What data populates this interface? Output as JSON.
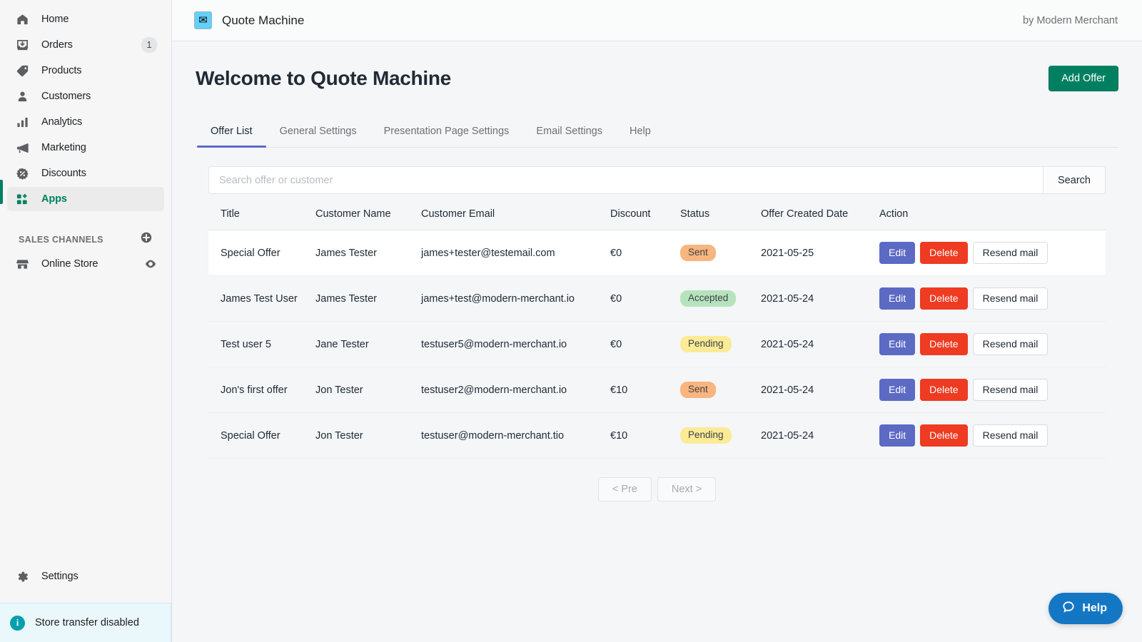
{
  "sidebar": {
    "items": [
      {
        "label": "Home",
        "icon": "home-icon",
        "badge": ""
      },
      {
        "label": "Orders",
        "icon": "orders-icon",
        "badge": "1"
      },
      {
        "label": "Products",
        "icon": "tag-icon",
        "badge": ""
      },
      {
        "label": "Customers",
        "icon": "person-icon",
        "badge": ""
      },
      {
        "label": "Analytics",
        "icon": "bar-chart-icon",
        "badge": ""
      },
      {
        "label": "Marketing",
        "icon": "megaphone-icon",
        "badge": ""
      },
      {
        "label": "Discounts",
        "icon": "discount-icon",
        "badge": ""
      },
      {
        "label": "Apps",
        "icon": "apps-icon",
        "badge": ""
      }
    ],
    "section_title": "SALES CHANNELS",
    "add_channel_icon": "plus-circle-icon",
    "channels": [
      {
        "label": "Online Store",
        "icon": "store-icon",
        "action_icon": "eye-icon"
      }
    ],
    "settings_label": "Settings",
    "settings_icon": "gear-icon",
    "banner": {
      "text": "Store transfer disabled",
      "icon": "info-icon"
    },
    "active_item": "Apps",
    "accent_color": "#008060"
  },
  "topbar": {
    "app_icon": "envelope-icon",
    "app_name": "Quote Machine",
    "author": "by Modern Merchant"
  },
  "page": {
    "title": "Welcome to Quote Machine",
    "add_offer_label": "Add Offer"
  },
  "tabs": [
    {
      "label": "Offer List",
      "active": true
    },
    {
      "label": "General Settings",
      "active": false
    },
    {
      "label": "Presentation Page Settings",
      "active": false
    },
    {
      "label": "Email Settings",
      "active": false
    },
    {
      "label": "Help",
      "active": false
    }
  ],
  "search": {
    "placeholder": "Search offer or customer",
    "value": "",
    "button_label": "Search"
  },
  "table": {
    "headers": [
      "Title",
      "Customer Name",
      "Customer Email",
      "Discount",
      "Status",
      "Offer Created Date",
      "Action"
    ],
    "action_labels": {
      "edit": "Edit",
      "delete": "Delete",
      "resend": "Resend mail"
    },
    "rows": [
      {
        "title": "Special Offer",
        "customer_name": "James Tester",
        "customer_email": "james+tester@testemail.com",
        "discount": "€0",
        "status": "Sent",
        "status_kind": "sent",
        "created": "2021-05-25",
        "highlight": true
      },
      {
        "title": "James Test User",
        "customer_name": "James Tester",
        "customer_email": "james+test@modern-merchant.io",
        "discount": "€0",
        "status": "Accepted",
        "status_kind": "accepted",
        "created": "2021-05-24",
        "highlight": false
      },
      {
        "title": "Test user 5",
        "customer_name": "Jane Tester",
        "customer_email": "testuser5@modern-merchant.io",
        "discount": "€0",
        "status": "Pending",
        "status_kind": "pending",
        "created": "2021-05-24",
        "highlight": false
      },
      {
        "title": "Jon's first offer",
        "customer_name": "Jon Tester",
        "customer_email": "testuser2@modern-merchant.io",
        "discount": "€10",
        "status": "Sent",
        "status_kind": "sent",
        "created": "2021-05-24",
        "highlight": false
      },
      {
        "title": "Special Offer",
        "customer_name": "Jon Tester",
        "customer_email": "testuser@modern-merchant.tio",
        "discount": "€10",
        "status": "Pending",
        "status_kind": "pending",
        "created": "2021-05-24",
        "highlight": false
      }
    ]
  },
  "pagination": {
    "prev_label": "< Pre",
    "next_label": "Next >"
  },
  "help_fab": {
    "label": "Help",
    "icon": "chat-bubble-icon",
    "color": "#1477c4"
  },
  "colors": {
    "accent_green": "#008060",
    "tab_underline": "#5c6ac4",
    "edit_button": "#5c6ac4",
    "delete_button": "#ee3b21",
    "status_sent": "#f8b57e",
    "status_accepted": "#b6e3bd",
    "status_pending": "#fbeb96",
    "help_blue": "#1477c4"
  }
}
